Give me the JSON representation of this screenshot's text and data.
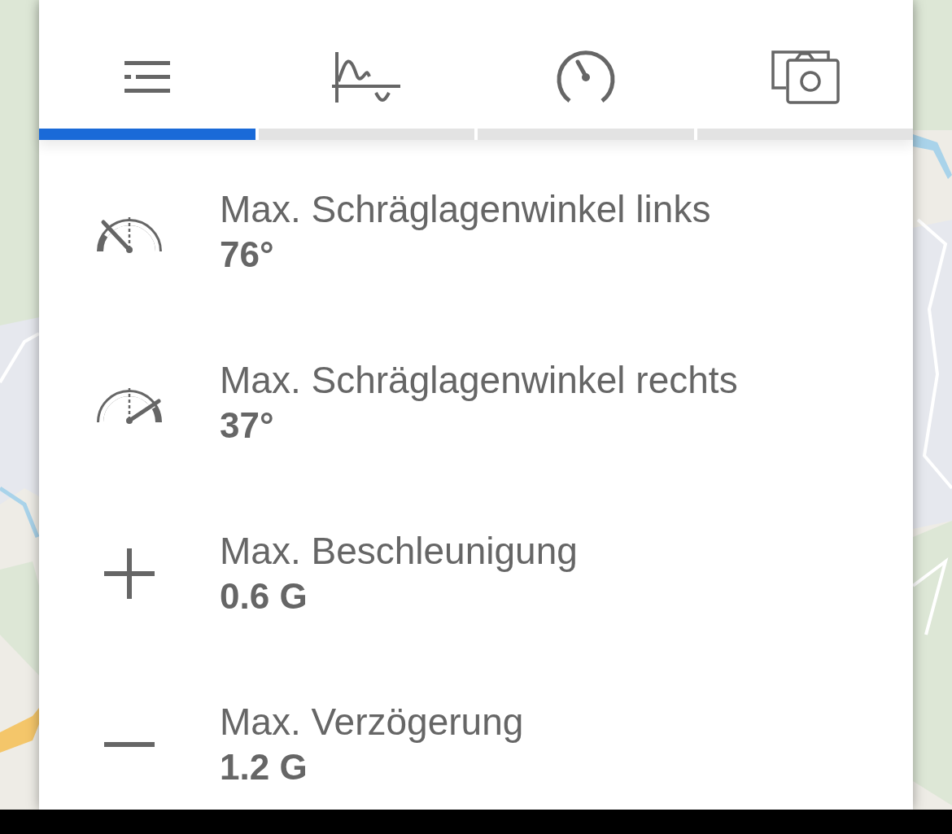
{
  "tabs": [
    {
      "kind": "list",
      "selected": true
    },
    {
      "kind": "graph",
      "selected": false
    },
    {
      "kind": "speedometer",
      "selected": false
    },
    {
      "kind": "photos",
      "selected": false
    }
  ],
  "stats": [
    {
      "kind": "lean-left",
      "label": "Max. Schräglagenwinkel links",
      "value": "76°"
    },
    {
      "kind": "lean-right",
      "label": "Max. Schräglagenwinkel rechts",
      "value": "37°"
    },
    {
      "kind": "plus",
      "label": "Max. Beschleunigung",
      "value": "0.6 G"
    },
    {
      "kind": "minus",
      "label": "Max. Verzögerung",
      "value": "1.2 G"
    }
  ]
}
